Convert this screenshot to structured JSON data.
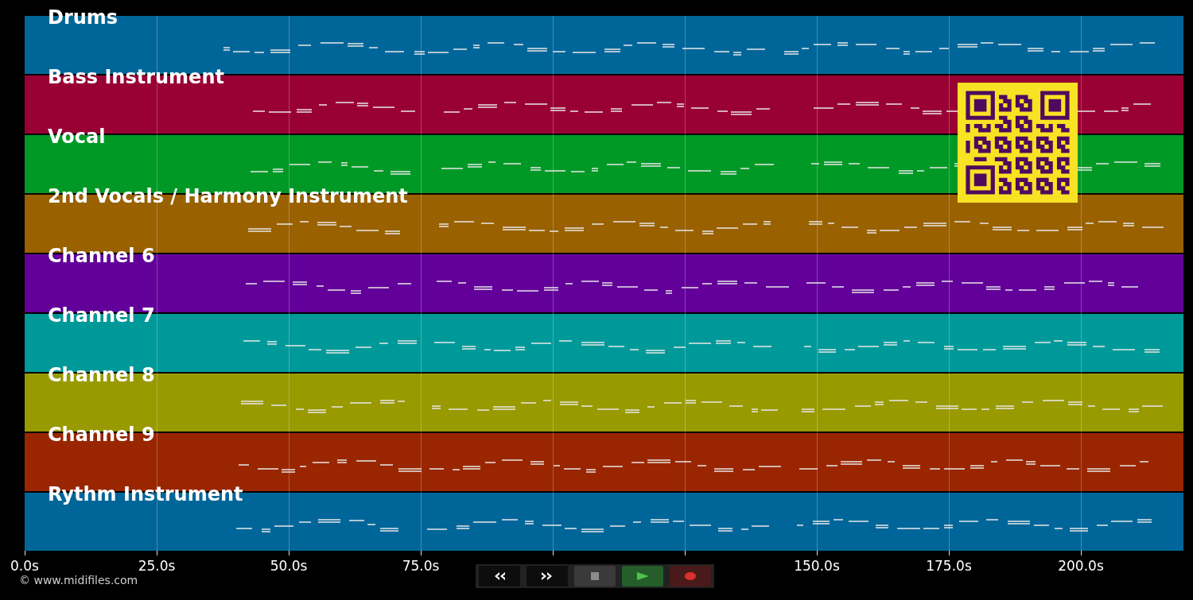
{
  "tracks": [
    {
      "name": "Drums",
      "color": "#006699"
    },
    {
      "name": "Bass Instrument",
      "color": "#990033"
    },
    {
      "name": "Vocal",
      "color": "#009926"
    },
    {
      "name": "2nd Vocals / Harmony Instrument",
      "color": "#996100"
    },
    {
      "name": "Channel 6",
      "color": "#620099"
    },
    {
      "name": "Channel 7",
      "color": "#009999"
    },
    {
      "name": "Channel 8",
      "color": "#999900"
    },
    {
      "name": "Channel 9",
      "color": "#992600"
    },
    {
      "name": "Rythm Instrument",
      "color": "#006699"
    }
  ],
  "time_axis": {
    "ticks": [
      {
        "label": "0.0s"
      },
      {
        "label": "25.0s"
      },
      {
        "label": "50.0s"
      },
      {
        "label": "75.0s"
      },
      {
        "covered": true
      },
      {
        "covered": true
      },
      {
        "label": "150.0s"
      },
      {
        "label": "175.0s"
      },
      {
        "label": "200.0s"
      }
    ]
  },
  "transport": [
    {
      "kind": "rewind"
    },
    {
      "kind": "forward"
    },
    {
      "kind": "stop"
    },
    {
      "kind": "play"
    },
    {
      "kind": "record"
    }
  ],
  "footer": {
    "copyright": "© www.midifiles.com"
  }
}
